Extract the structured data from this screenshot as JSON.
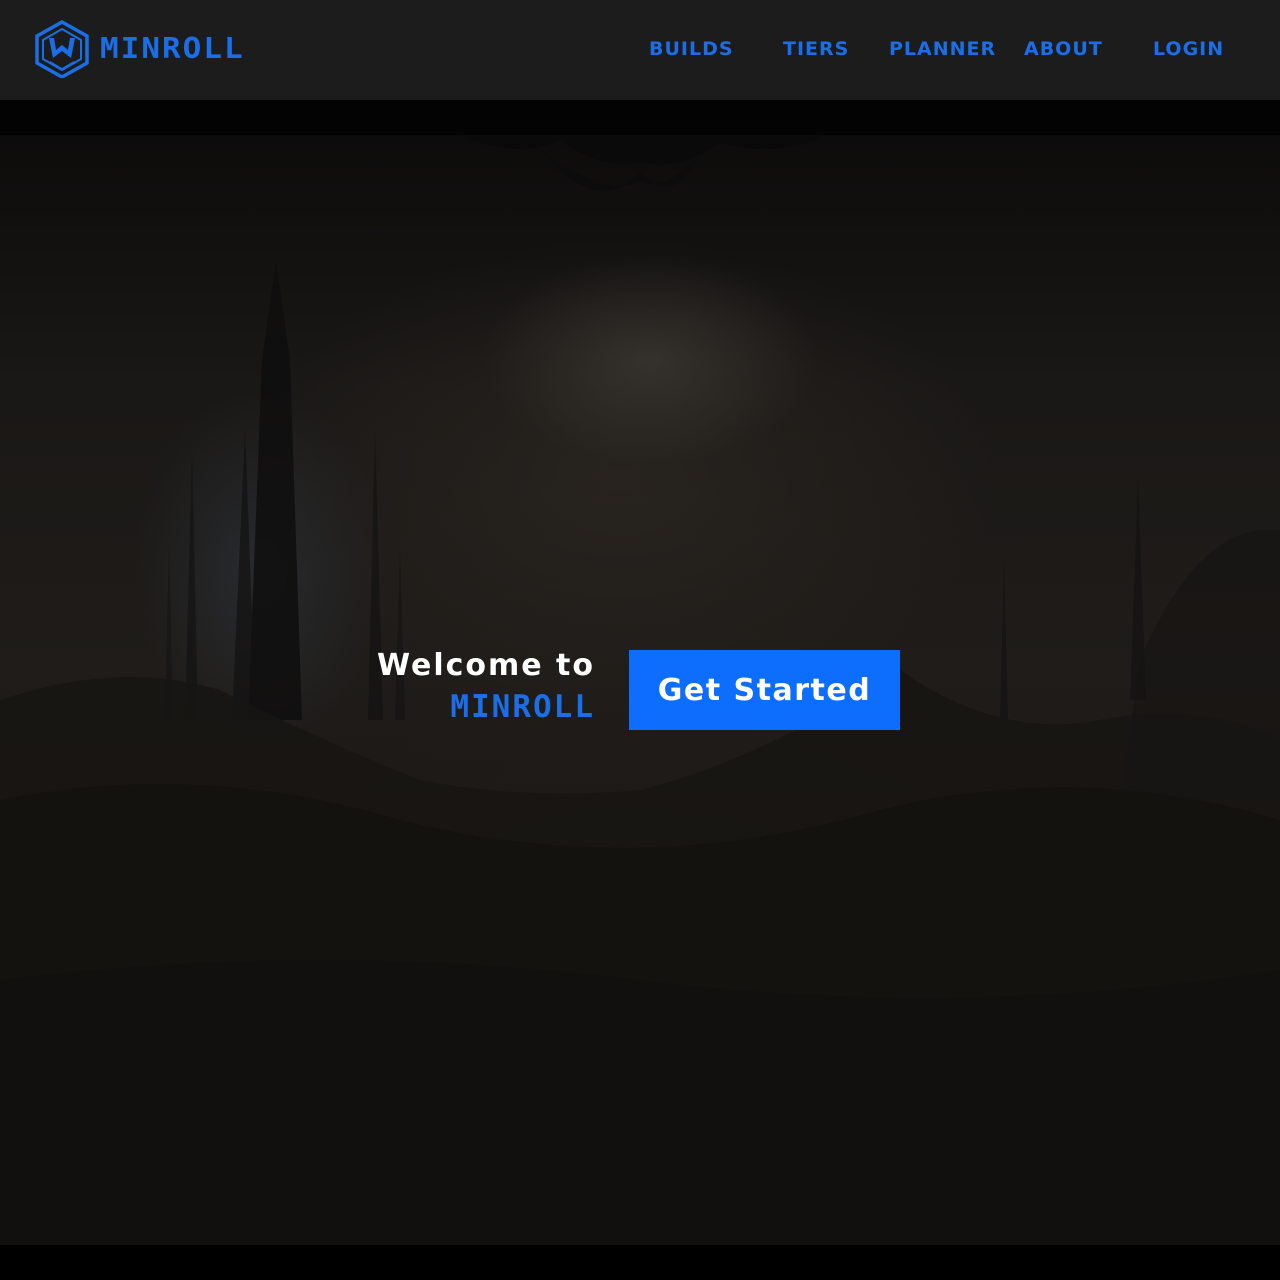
{
  "brand": {
    "name": "MINROLL",
    "logo_icon": "hexagon-w-logo-icon",
    "accent_color": "#1a6fe8"
  },
  "nav": {
    "items": [
      {
        "label": "BUILDS"
      },
      {
        "label": "TIERS"
      },
      {
        "label": "PLANNER"
      },
      {
        "label": "ABOUT"
      },
      {
        "label": "LOGIN"
      }
    ]
  },
  "hero": {
    "welcome": "Welcome to",
    "brand": "MINROLL",
    "cta_label": "Get Started",
    "cta_color": "#0d6efd"
  }
}
